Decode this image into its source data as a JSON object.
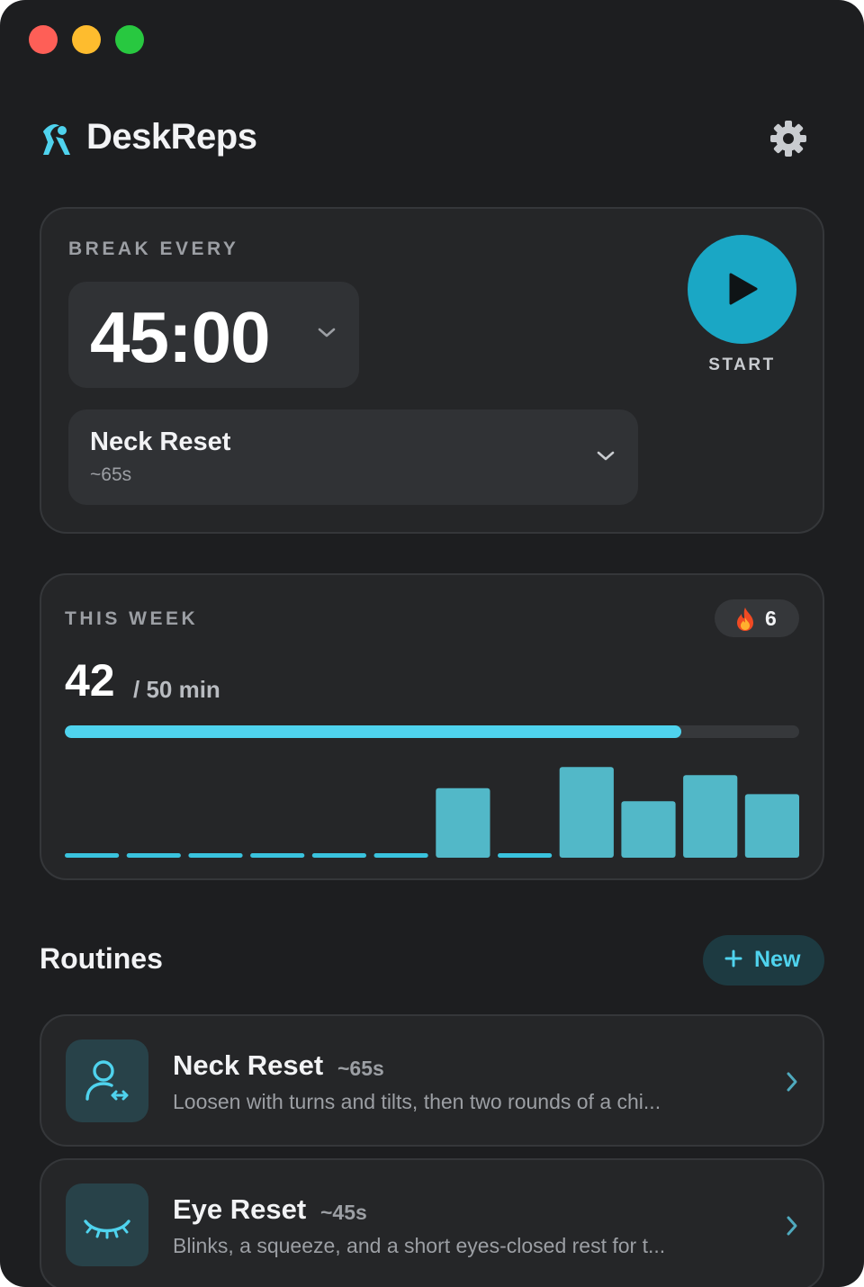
{
  "app": {
    "title": "DeskReps",
    "logo_icon": "figure-icon",
    "settings_icon": "gear-icon",
    "accent": "#4fd3ee",
    "start_color": "#1aa7c5"
  },
  "timer": {
    "label": "BREAK EVERY",
    "value": "45:00",
    "start_label": "START",
    "routine_name": "Neck Reset",
    "routine_duration": "~65s"
  },
  "week": {
    "label": "THIS WEEK",
    "streak_icon": "flame-icon",
    "streak": "6",
    "minutes": "42",
    "goal": "/ 50 min",
    "progress": 0.84
  },
  "chart_data": {
    "type": "bar",
    "values": [
      0,
      0,
      0,
      0,
      0,
      0,
      0.69,
      0,
      0.9,
      0.56,
      0.82,
      0.63
    ],
    "color": "#52b8c8",
    "baseline_color": "#3ac3de"
  },
  "routines": {
    "title": "Routines",
    "new_label": "New",
    "items": [
      {
        "name": "Neck Reset",
        "duration": "~65s",
        "description": "Loosen with turns and tilts, then two rounds of a chi...",
        "icon": "person-icon"
      },
      {
        "name": "Eye Reset",
        "duration": "~45s",
        "description": "Blinks, a squeeze, and a short eyes-closed rest for t...",
        "icon": "closed-eye-icon"
      }
    ]
  }
}
